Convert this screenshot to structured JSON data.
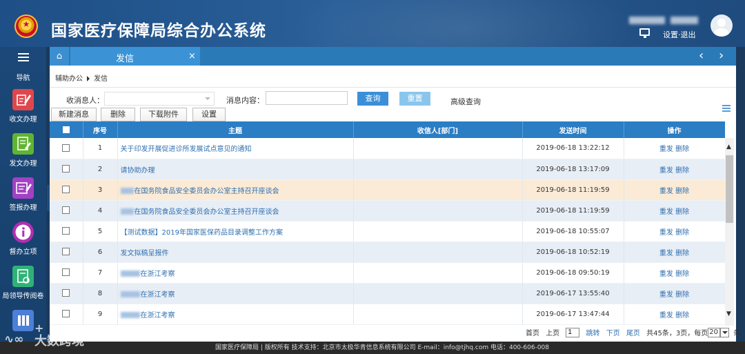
{
  "header": {
    "title": "国家医疗保障局综合办公系统",
    "settings_logout": "设置·退出"
  },
  "sidebar": {
    "nav_label": "导航",
    "items": [
      {
        "label": "收文办理",
        "icon": "pen-document-icon",
        "color": "#e0474c"
      },
      {
        "label": "发文办理",
        "icon": "edit-document-icon",
        "color": "#5fb531"
      },
      {
        "label": "签报办理",
        "icon": "sign-document-icon",
        "color": "#a340c4"
      },
      {
        "label": "督办立项",
        "icon": "info-icon",
        "color": "#b02fb0"
      },
      {
        "label": "局领导传阅卷",
        "icon": "circulation-document-icon",
        "color": "#2fb277"
      }
    ]
  },
  "tabs": {
    "active": "发信",
    "close": "×",
    "prev": "‹",
    "next": "›"
  },
  "breadcrumb": {
    "parent": "辅助办公",
    "current": "发信"
  },
  "search": {
    "receiver_label": "收消息人：",
    "content_label": "消息内容：",
    "content_value": "",
    "query_button": "查询",
    "reset_button": "重置",
    "advanced_query": "高级查询"
  },
  "toolbar": {
    "new_message": "新建消息",
    "delete": "删除",
    "download_attachment": "下载附件",
    "settings": "设置"
  },
  "table": {
    "columns": [
      "序号",
      "主题",
      "收信人[部门]",
      "发送时间",
      "操作"
    ],
    "rows": [
      {
        "no": "1",
        "subject": "关于印发开展促进诊所发展试点意见的通知",
        "subject_prefix_blurred": false,
        "recipient": "",
        "time": "2019-06-18 13:22:12",
        "resend": "重发",
        "delete": "删除"
      },
      {
        "no": "2",
        "subject": "请协助办理",
        "subject_prefix_blurred": false,
        "recipient": "",
        "time": "2019-06-18 13:17:09",
        "resend": "重发",
        "delete": "删除"
      },
      {
        "no": "3",
        "subject": "在国务院食品安全委员会办公室主持召开座谈会",
        "subject_prefix_blurred": true,
        "recipient": "",
        "time": "2019-06-18 11:19:59",
        "resend": "重发",
        "delete": "删除"
      },
      {
        "no": "4",
        "subject": "在国务院食品安全委员会办公室主持召开座谈会",
        "subject_prefix_blurred": true,
        "recipient": "",
        "time": "2019-06-18 11:19:59",
        "resend": "重发",
        "delete": "删除"
      },
      {
        "no": "5",
        "subject": "【测试数据】2019年国家医保药品目录调整工作方案",
        "subject_prefix_blurred": false,
        "recipient": "",
        "time": "2019-06-18 10:55:07",
        "resend": "重发",
        "delete": "删除"
      },
      {
        "no": "6",
        "subject": "发文拟稿呈报件",
        "subject_prefix_blurred": false,
        "recipient": "",
        "time": "2019-06-18 10:52:19",
        "resend": "重发",
        "delete": "删除"
      },
      {
        "no": "7",
        "subject": "在浙江考察",
        "subject_prefix_blurred": true,
        "recipient": "",
        "time": "2019-06-18 09:50:19",
        "resend": "重发",
        "delete": "删除"
      },
      {
        "no": "8",
        "subject": "在浙江考察",
        "subject_prefix_blurred": true,
        "recipient": "",
        "time": "2019-06-17 13:55:40",
        "resend": "重发",
        "delete": "删除"
      },
      {
        "no": "9",
        "subject": "在浙江考察",
        "subject_prefix_blurred": true,
        "recipient": "",
        "time": "2019-06-17 13:47:44",
        "resend": "重发",
        "delete": "删除"
      }
    ]
  },
  "pager": {
    "first": "首页",
    "prev": "上页",
    "page_value": "1",
    "jump": "跳转",
    "next": "下页",
    "last": "尾页",
    "summary": "共45条，3页，每页",
    "page_size": "20",
    "unit": "条"
  },
  "footer": {
    "text": "国家医疗保障局 | 版权所有 技术支持：北京市太极华青信息系统有限公司 E-mail：info@tjhq.com 电话：400-606-008"
  },
  "watermark": {
    "name": "大数跨境",
    "plus": "+"
  },
  "colors": {
    "header_bg": "#2a5f98",
    "tab_bar": "#2a7ab8",
    "table_header": "#2b7dc4",
    "link": "#2e6fb0",
    "highlight_row": "#fbebd6"
  }
}
